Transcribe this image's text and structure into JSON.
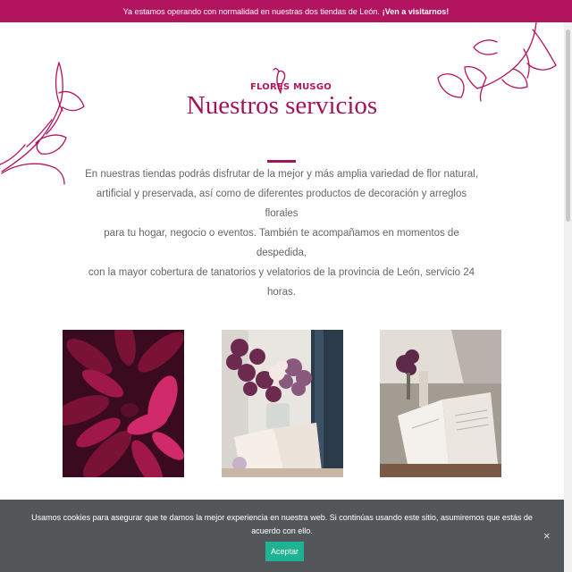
{
  "topbar": {
    "message": "Ya estamos operando con normalidad en nuestras dos tiendas de León.",
    "cta": "¡Ven a visitarnos!"
  },
  "brand": {
    "logo_text": "FLORES MUSGO"
  },
  "section": {
    "title": "Nuestros servicios",
    "intro_lines": [
      "En nuestras tiendas podrás disfrutar de la mejor y más amplia variedad de flor natural,",
      "artificial y preservada, así como de diferentes productos de decoración y arreglos florales",
      "para tu hogar, negocio o eventos. También te acompañamos en momentos de despedida,",
      "con la mayor cobertura de tanatorios y velatorios de la provincia de León, servicio 24 horas."
    ]
  },
  "cookie": {
    "text": "Usamos cookies para asegurar que te damos la mejor experiencia en nuestra web. Si continúas usando este sitio, asumiremos que estás de acuerdo con ello.",
    "accept_label": "Aceptar",
    "close_label": "×"
  },
  "colors": {
    "brand": "#b3145f",
    "title": "#a2145a",
    "cookie_bg": "#54575a",
    "accept": "#1fb293"
  }
}
